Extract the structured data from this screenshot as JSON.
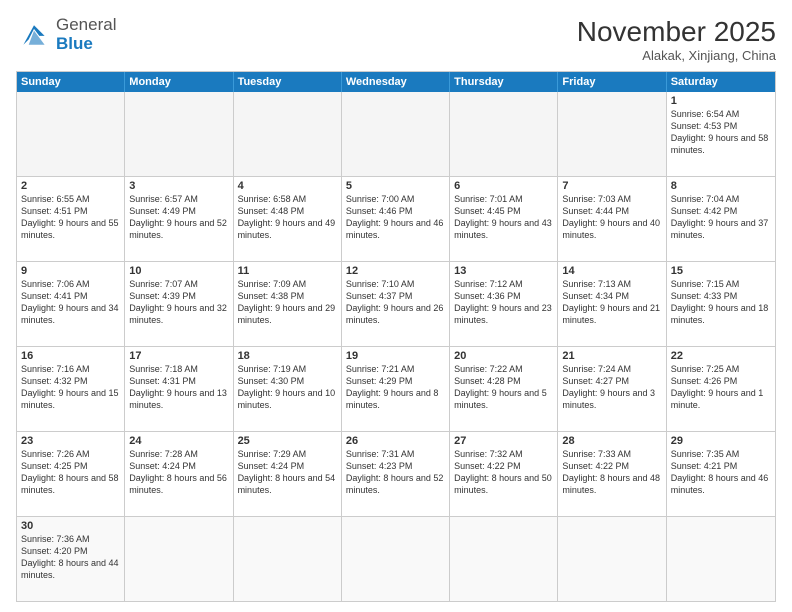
{
  "header": {
    "logo_general": "General",
    "logo_blue": "Blue",
    "month_title": "November 2025",
    "location": "Alakak, Xinjiang, China"
  },
  "days_of_week": [
    "Sunday",
    "Monday",
    "Tuesday",
    "Wednesday",
    "Thursday",
    "Friday",
    "Saturday"
  ],
  "rows": [
    [
      {
        "day": "",
        "text": ""
      },
      {
        "day": "",
        "text": ""
      },
      {
        "day": "",
        "text": ""
      },
      {
        "day": "",
        "text": ""
      },
      {
        "day": "",
        "text": ""
      },
      {
        "day": "",
        "text": ""
      },
      {
        "day": "1",
        "text": "Sunrise: 6:54 AM\nSunset: 4:53 PM\nDaylight: 9 hours and 58 minutes."
      }
    ],
    [
      {
        "day": "2",
        "text": "Sunrise: 6:55 AM\nSunset: 4:51 PM\nDaylight: 9 hours and 55 minutes."
      },
      {
        "day": "3",
        "text": "Sunrise: 6:57 AM\nSunset: 4:49 PM\nDaylight: 9 hours and 52 minutes."
      },
      {
        "day": "4",
        "text": "Sunrise: 6:58 AM\nSunset: 4:48 PM\nDaylight: 9 hours and 49 minutes."
      },
      {
        "day": "5",
        "text": "Sunrise: 7:00 AM\nSunset: 4:46 PM\nDaylight: 9 hours and 46 minutes."
      },
      {
        "day": "6",
        "text": "Sunrise: 7:01 AM\nSunset: 4:45 PM\nDaylight: 9 hours and 43 minutes."
      },
      {
        "day": "7",
        "text": "Sunrise: 7:03 AM\nSunset: 4:44 PM\nDaylight: 9 hours and 40 minutes."
      },
      {
        "day": "8",
        "text": "Sunrise: 7:04 AM\nSunset: 4:42 PM\nDaylight: 9 hours and 37 minutes."
      }
    ],
    [
      {
        "day": "9",
        "text": "Sunrise: 7:06 AM\nSunset: 4:41 PM\nDaylight: 9 hours and 34 minutes."
      },
      {
        "day": "10",
        "text": "Sunrise: 7:07 AM\nSunset: 4:39 PM\nDaylight: 9 hours and 32 minutes."
      },
      {
        "day": "11",
        "text": "Sunrise: 7:09 AM\nSunset: 4:38 PM\nDaylight: 9 hours and 29 minutes."
      },
      {
        "day": "12",
        "text": "Sunrise: 7:10 AM\nSunset: 4:37 PM\nDaylight: 9 hours and 26 minutes."
      },
      {
        "day": "13",
        "text": "Sunrise: 7:12 AM\nSunset: 4:36 PM\nDaylight: 9 hours and 23 minutes."
      },
      {
        "day": "14",
        "text": "Sunrise: 7:13 AM\nSunset: 4:34 PM\nDaylight: 9 hours and 21 minutes."
      },
      {
        "day": "15",
        "text": "Sunrise: 7:15 AM\nSunset: 4:33 PM\nDaylight: 9 hours and 18 minutes."
      }
    ],
    [
      {
        "day": "16",
        "text": "Sunrise: 7:16 AM\nSunset: 4:32 PM\nDaylight: 9 hours and 15 minutes."
      },
      {
        "day": "17",
        "text": "Sunrise: 7:18 AM\nSunset: 4:31 PM\nDaylight: 9 hours and 13 minutes."
      },
      {
        "day": "18",
        "text": "Sunrise: 7:19 AM\nSunset: 4:30 PM\nDaylight: 9 hours and 10 minutes."
      },
      {
        "day": "19",
        "text": "Sunrise: 7:21 AM\nSunset: 4:29 PM\nDaylight: 9 hours and 8 minutes."
      },
      {
        "day": "20",
        "text": "Sunrise: 7:22 AM\nSunset: 4:28 PM\nDaylight: 9 hours and 5 minutes."
      },
      {
        "day": "21",
        "text": "Sunrise: 7:24 AM\nSunset: 4:27 PM\nDaylight: 9 hours and 3 minutes."
      },
      {
        "day": "22",
        "text": "Sunrise: 7:25 AM\nSunset: 4:26 PM\nDaylight: 9 hours and 1 minute."
      }
    ],
    [
      {
        "day": "23",
        "text": "Sunrise: 7:26 AM\nSunset: 4:25 PM\nDaylight: 8 hours and 58 minutes."
      },
      {
        "day": "24",
        "text": "Sunrise: 7:28 AM\nSunset: 4:24 PM\nDaylight: 8 hours and 56 minutes."
      },
      {
        "day": "25",
        "text": "Sunrise: 7:29 AM\nSunset: 4:24 PM\nDaylight: 8 hours and 54 minutes."
      },
      {
        "day": "26",
        "text": "Sunrise: 7:31 AM\nSunset: 4:23 PM\nDaylight: 8 hours and 52 minutes."
      },
      {
        "day": "27",
        "text": "Sunrise: 7:32 AM\nSunset: 4:22 PM\nDaylight: 8 hours and 50 minutes."
      },
      {
        "day": "28",
        "text": "Sunrise: 7:33 AM\nSunset: 4:22 PM\nDaylight: 8 hours and 48 minutes."
      },
      {
        "day": "29",
        "text": "Sunrise: 7:35 AM\nSunset: 4:21 PM\nDaylight: 8 hours and 46 minutes."
      }
    ],
    [
      {
        "day": "30",
        "text": "Sunrise: 7:36 AM\nSunset: 4:20 PM\nDaylight: 8 hours and 44 minutes."
      },
      {
        "day": "",
        "text": ""
      },
      {
        "day": "",
        "text": ""
      },
      {
        "day": "",
        "text": ""
      },
      {
        "day": "",
        "text": ""
      },
      {
        "day": "",
        "text": ""
      },
      {
        "day": "",
        "text": ""
      }
    ]
  ]
}
